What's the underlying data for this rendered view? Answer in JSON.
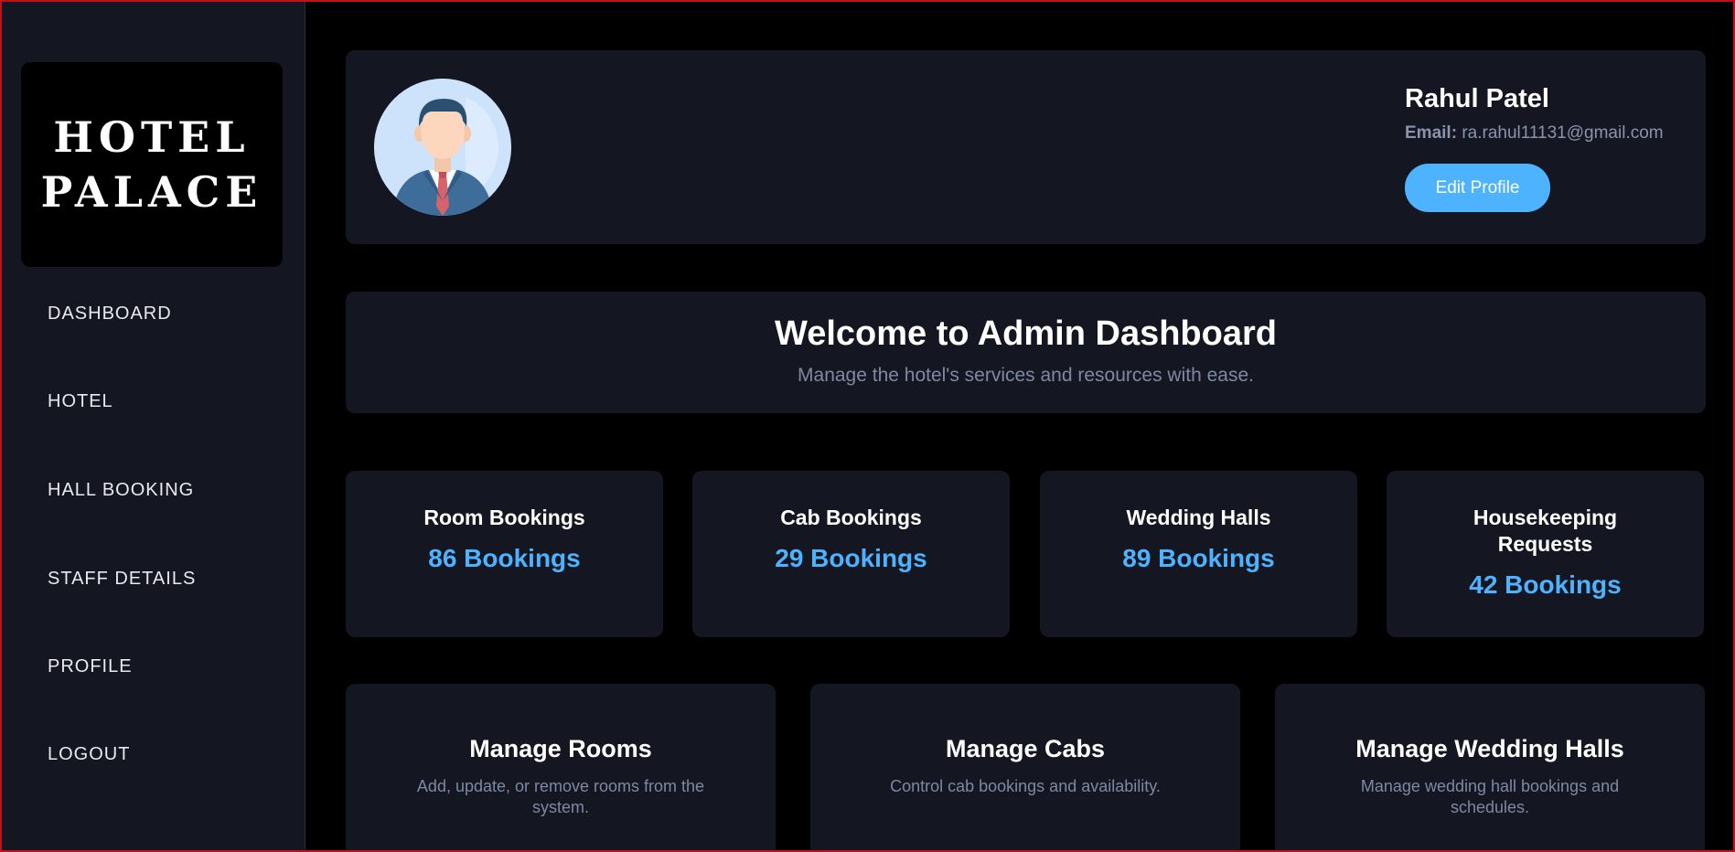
{
  "brand": {
    "line1": "HOTEL",
    "line2": "PALACE"
  },
  "nav": [
    {
      "label": "DASHBOARD"
    },
    {
      "label": "HOTEL"
    },
    {
      "label": "HALL BOOKING"
    },
    {
      "label": "STAFF DETAILS"
    },
    {
      "label": "PROFILE"
    },
    {
      "label": "LOGOUT"
    }
  ],
  "profile": {
    "name": "Rahul Patel",
    "email_label": "Email:",
    "email": "ra.rahul11131@gmail.com",
    "edit_label": "Edit Profile",
    "avatar_icon": "businessman-avatar-icon"
  },
  "welcome": {
    "title": "Welcome to Admin Dashboard",
    "subtitle": "Manage the hotel's services and resources with ease."
  },
  "stats": [
    {
      "title": "Room Bookings",
      "value": "86 Bookings"
    },
    {
      "title": "Cab Bookings",
      "value": "29 Bookings"
    },
    {
      "title": "Wedding Halls",
      "value": "89 Bookings"
    },
    {
      "title": "Housekeeping Requests",
      "value": "42 Bookings"
    }
  ],
  "manage": [
    {
      "title": "Manage Rooms",
      "desc": "Add, update, or remove rooms from the system."
    },
    {
      "title": "Manage Cabs",
      "desc": "Control cab bookings and availability."
    },
    {
      "title": "Manage Wedding Halls",
      "desc": "Manage wedding hall bookings and schedules."
    }
  ],
  "colors": {
    "accent": "#4db3ff",
    "card_bg": "#141722",
    "page_bg": "#000000",
    "frame_border": "#c0101a"
  }
}
